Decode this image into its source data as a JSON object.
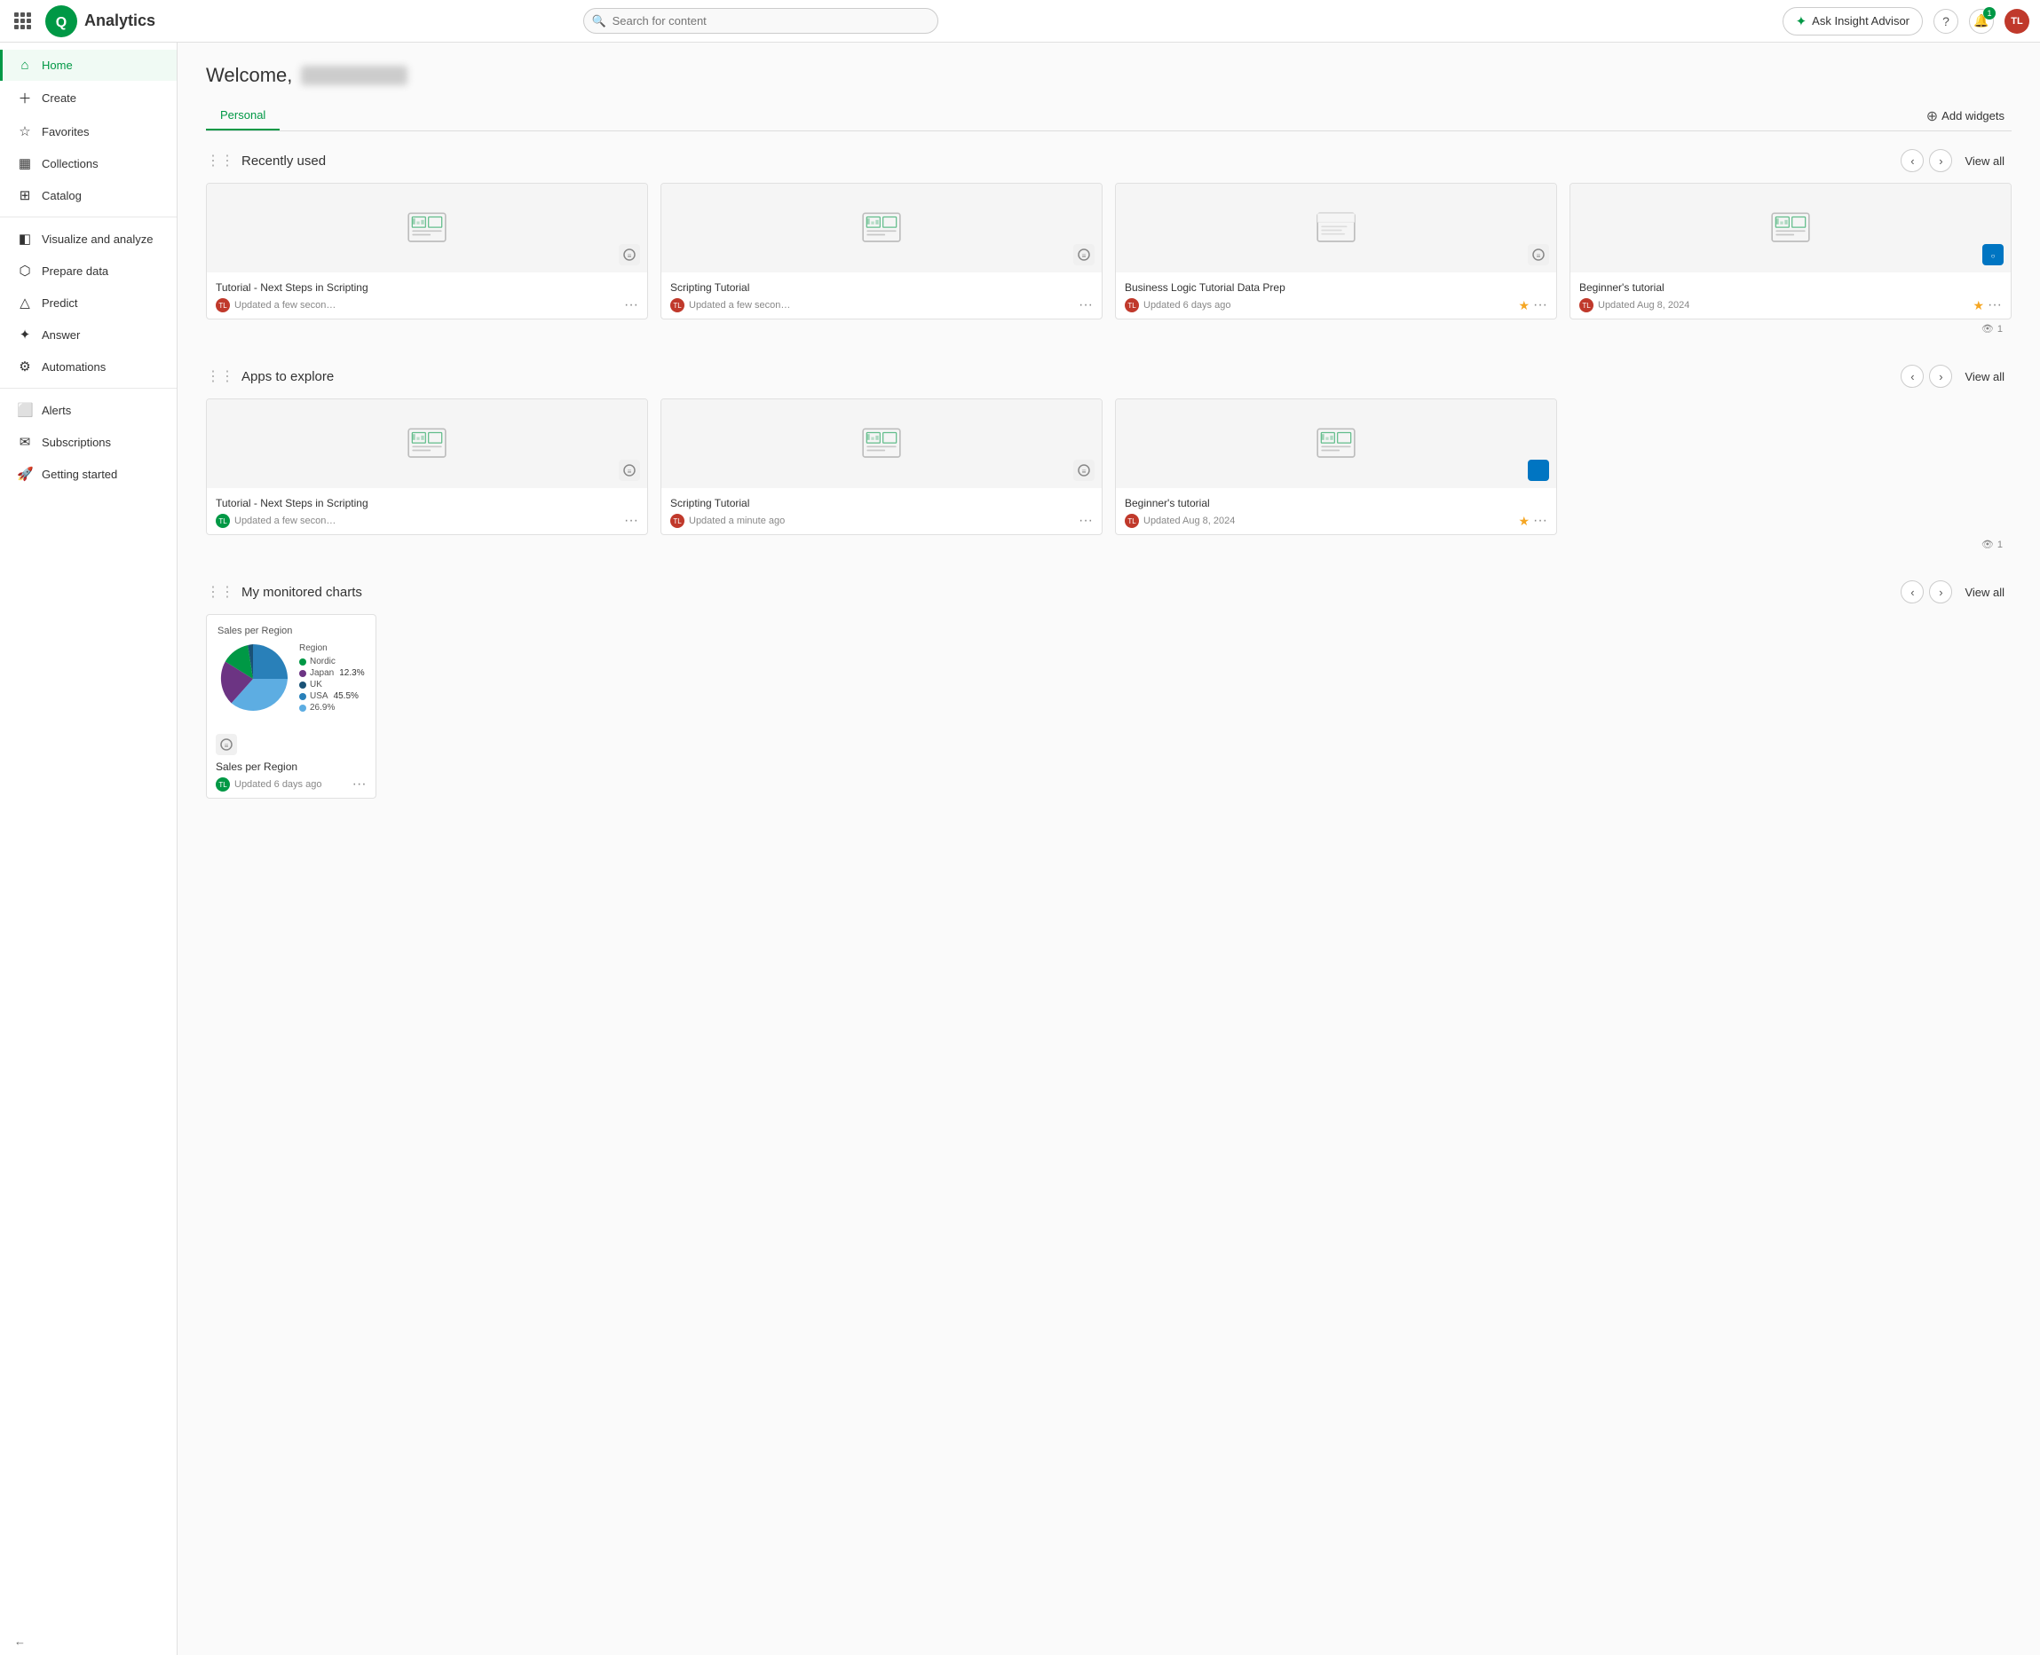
{
  "topbar": {
    "logo_text": "Qlik",
    "app_name": "Analytics",
    "search_placeholder": "Search for content",
    "insight_advisor_label": "Ask Insight Advisor",
    "notifications_count": "1",
    "avatar_initials": "TL"
  },
  "sidebar": {
    "items": [
      {
        "id": "home",
        "label": "Home",
        "icon": "🏠",
        "active": true
      },
      {
        "id": "create",
        "label": "Create",
        "icon": "+",
        "active": false
      },
      {
        "id": "favorites",
        "label": "Favorites",
        "icon": "☆",
        "active": false
      },
      {
        "id": "collections",
        "label": "Collections",
        "icon": "⊡",
        "active": false
      },
      {
        "id": "catalog",
        "label": "Catalog",
        "icon": "⊞",
        "active": false
      },
      {
        "id": "visualize",
        "label": "Visualize and analyze",
        "icon": "◫",
        "active": false
      },
      {
        "id": "prepare",
        "label": "Prepare data",
        "icon": "⬡",
        "active": false
      },
      {
        "id": "predict",
        "label": "Predict",
        "icon": "△",
        "active": false
      },
      {
        "id": "answer",
        "label": "Answer",
        "icon": "✦",
        "active": false
      },
      {
        "id": "automations",
        "label": "Automations",
        "icon": "⚙",
        "active": false
      },
      {
        "id": "alerts",
        "label": "Alerts",
        "icon": "⬜",
        "active": false
      },
      {
        "id": "subscriptions",
        "label": "Subscriptions",
        "icon": "✉",
        "active": false
      },
      {
        "id": "getting-started",
        "label": "Getting started",
        "icon": "🚀",
        "active": false
      }
    ],
    "collapse_label": "←"
  },
  "main": {
    "welcome_text": "Welcome,",
    "tabs": [
      {
        "id": "personal",
        "label": "Personal",
        "active": true
      }
    ],
    "add_widgets_label": "Add widgets",
    "sections": {
      "recently_used": {
        "title": "Recently used",
        "view_all": "View all",
        "cards": [
          {
            "id": "card1",
            "title": "Tutorial - Next Steps in Scripting",
            "updated": "Updated a few seconds ago",
            "avatar_initials": "TL",
            "avatar_color": "red",
            "starred": false,
            "icon_type": "app"
          },
          {
            "id": "card2",
            "title": "Scripting Tutorial",
            "updated": "Updated a few seconds ago",
            "avatar_initials": "TL",
            "avatar_color": "red",
            "starred": false,
            "icon_type": "app"
          },
          {
            "id": "card3",
            "title": "Business Logic Tutorial Data Prep",
            "updated": "Updated 6 days ago",
            "avatar_initials": "TL",
            "avatar_color": "red",
            "starred": true,
            "icon_type": "app"
          },
          {
            "id": "card4",
            "title": "Beginner's tutorial",
            "updated": "Updated Aug 8, 2024",
            "avatar_initials": "TL",
            "avatar_color": "red",
            "starred": true,
            "icon_type": "blue"
          }
        ],
        "views_count": "1"
      },
      "apps_to_explore": {
        "title": "Apps to explore",
        "view_all": "View all",
        "cards": [
          {
            "id": "exp1",
            "title": "Tutorial - Next Steps in Scripting",
            "updated": "Updated a few seconds ago",
            "avatar_initials": "TL",
            "avatar_color": "green",
            "starred": false,
            "icon_type": "app"
          },
          {
            "id": "exp2",
            "title": "Scripting Tutorial",
            "updated": "Updated a minute ago",
            "avatar_initials": "TL",
            "avatar_color": "red",
            "starred": false,
            "icon_type": "app"
          },
          {
            "id": "exp3",
            "title": "Beginner's tutorial",
            "updated": "Updated Aug 8, 2024",
            "avatar_initials": "TL",
            "avatar_color": "red",
            "starred": true,
            "icon_type": "blue"
          }
        ],
        "views_count": "1"
      },
      "my_monitored_charts": {
        "title": "My monitored charts",
        "view_all": "View all",
        "chart": {
          "title": "Sales per Region",
          "updated": "Updated 6 days ago",
          "avatar_initials": "TL",
          "avatar_color": "green",
          "chart_heading": "Region",
          "legend": [
            {
              "label": "Nordic",
              "color": "#009845",
              "percent": ""
            },
            {
              "label": "Japan",
              "color": "#6c3483",
              "percent": "12.3%"
            },
            {
              "label": "UK",
              "color": "#1a5276",
              "percent": ""
            },
            {
              "label": "USA",
              "color": "#2980b9",
              "percent": "45.5%"
            },
            {
              "label": "",
              "color": "#5dade2",
              "percent": "26.9%"
            }
          ],
          "pie_segments": [
            {
              "color": "#2980b9",
              "start": 0,
              "end": 164
            },
            {
              "color": "#5dade2",
              "start": 164,
              "end": 261
            },
            {
              "color": "#6c3483",
              "start": 261,
              "end": 305
            },
            {
              "color": "#009845",
              "start": 305,
              "end": 340
            },
            {
              "color": "#1a5276",
              "start": 340,
              "end": 360
            }
          ]
        }
      }
    }
  }
}
